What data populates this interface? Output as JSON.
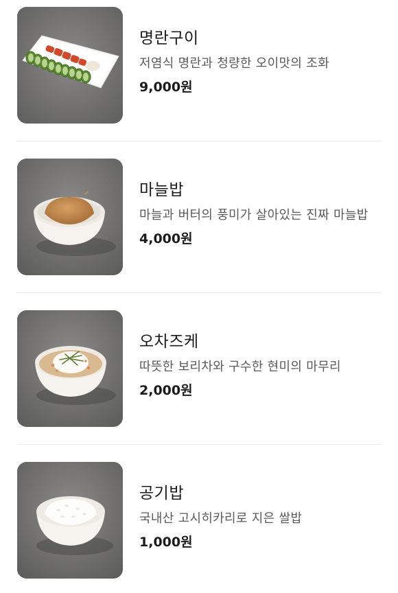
{
  "menu": {
    "items": [
      {
        "name": "명란구이",
        "description": "저염식 명란과 청량한 오이맛의 조화",
        "price": "9,000원",
        "image_icon": "mentaiko-plate-photo"
      },
      {
        "name": "마늘밥",
        "description": "마늘과 버터의 풍미가 살아있는 진짜 마늘밥",
        "price": "4,000원",
        "image_icon": "garlic-rice-bowl-photo"
      },
      {
        "name": "오차즈케",
        "description": "따뜻한 보리차와 구수한 현미의 마무리",
        "price": "2,000원",
        "image_icon": "ochazuke-bowl-photo"
      },
      {
        "name": "공기밥",
        "description": "국내산 고시히카리로 지은 쌀밥",
        "price": "1,000원",
        "image_icon": "steamed-rice-bowl-photo"
      }
    ]
  },
  "colors": {
    "background": "#ffffff",
    "divider": "#ececec",
    "name_text": "#1b1b1b",
    "description_text": "#5a5a5a",
    "photo_backdrop": "#6e6e6c"
  }
}
